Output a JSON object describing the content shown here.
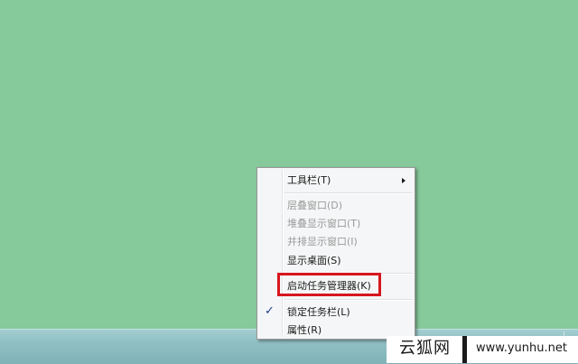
{
  "desktop": {
    "background_color": "#86c99b"
  },
  "context_menu": {
    "items": [
      {
        "label": "工具栏(T)",
        "enabled": true,
        "has_submenu": true
      },
      {
        "label": "层叠窗口(D)",
        "enabled": false
      },
      {
        "label": "堆叠显示窗口(T)",
        "enabled": false
      },
      {
        "label": "并排显示窗口(I)",
        "enabled": false
      },
      {
        "label": "显示桌面(S)",
        "enabled": true
      },
      {
        "label": "启动任务管理器(K)",
        "enabled": true,
        "highlighted": true
      },
      {
        "label": "锁定任务栏(L)",
        "enabled": true,
        "checked": true,
        "check_mark": "✓"
      },
      {
        "label": "属性(R)",
        "enabled": true
      }
    ],
    "highlight_color": "#d7161f"
  },
  "watermark": {
    "site_name": "云狐网",
    "url": "www.yunhu.net"
  }
}
